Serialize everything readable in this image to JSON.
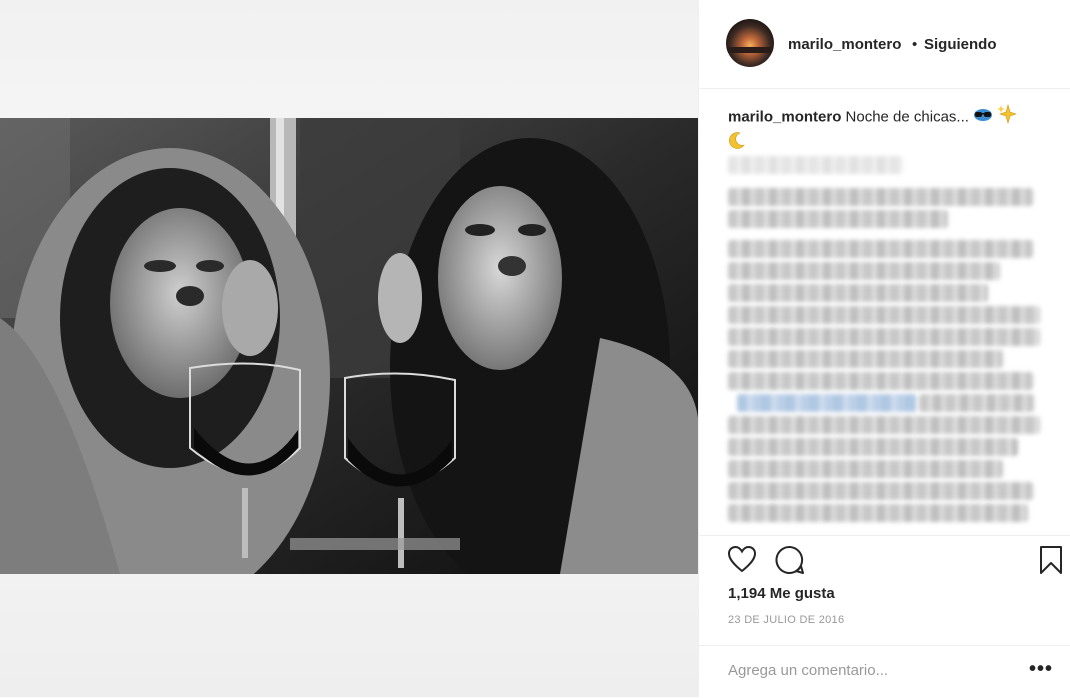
{
  "post": {
    "username": "marilo_montero",
    "follow_separator": "•",
    "follow_status": "Siguiendo",
    "caption_user": "marilo_montero",
    "caption_text": "Noche de chicas...",
    "caption_emojis": [
      "sunglasses-emoji",
      "sparkles-emoji",
      "crescent-moon-emoji"
    ],
    "likes": "1,194 Me gusta",
    "date": "23 DE JULIO DE 2016",
    "comment_placeholder": "Agrega un comentario...",
    "more_label": "•••"
  },
  "icons": {
    "like": "heart-icon",
    "comment": "speech-bubble-icon",
    "save": "bookmark-icon"
  },
  "colors": {
    "text": "#262626",
    "secondary": "#999999",
    "divider": "#efefef"
  }
}
